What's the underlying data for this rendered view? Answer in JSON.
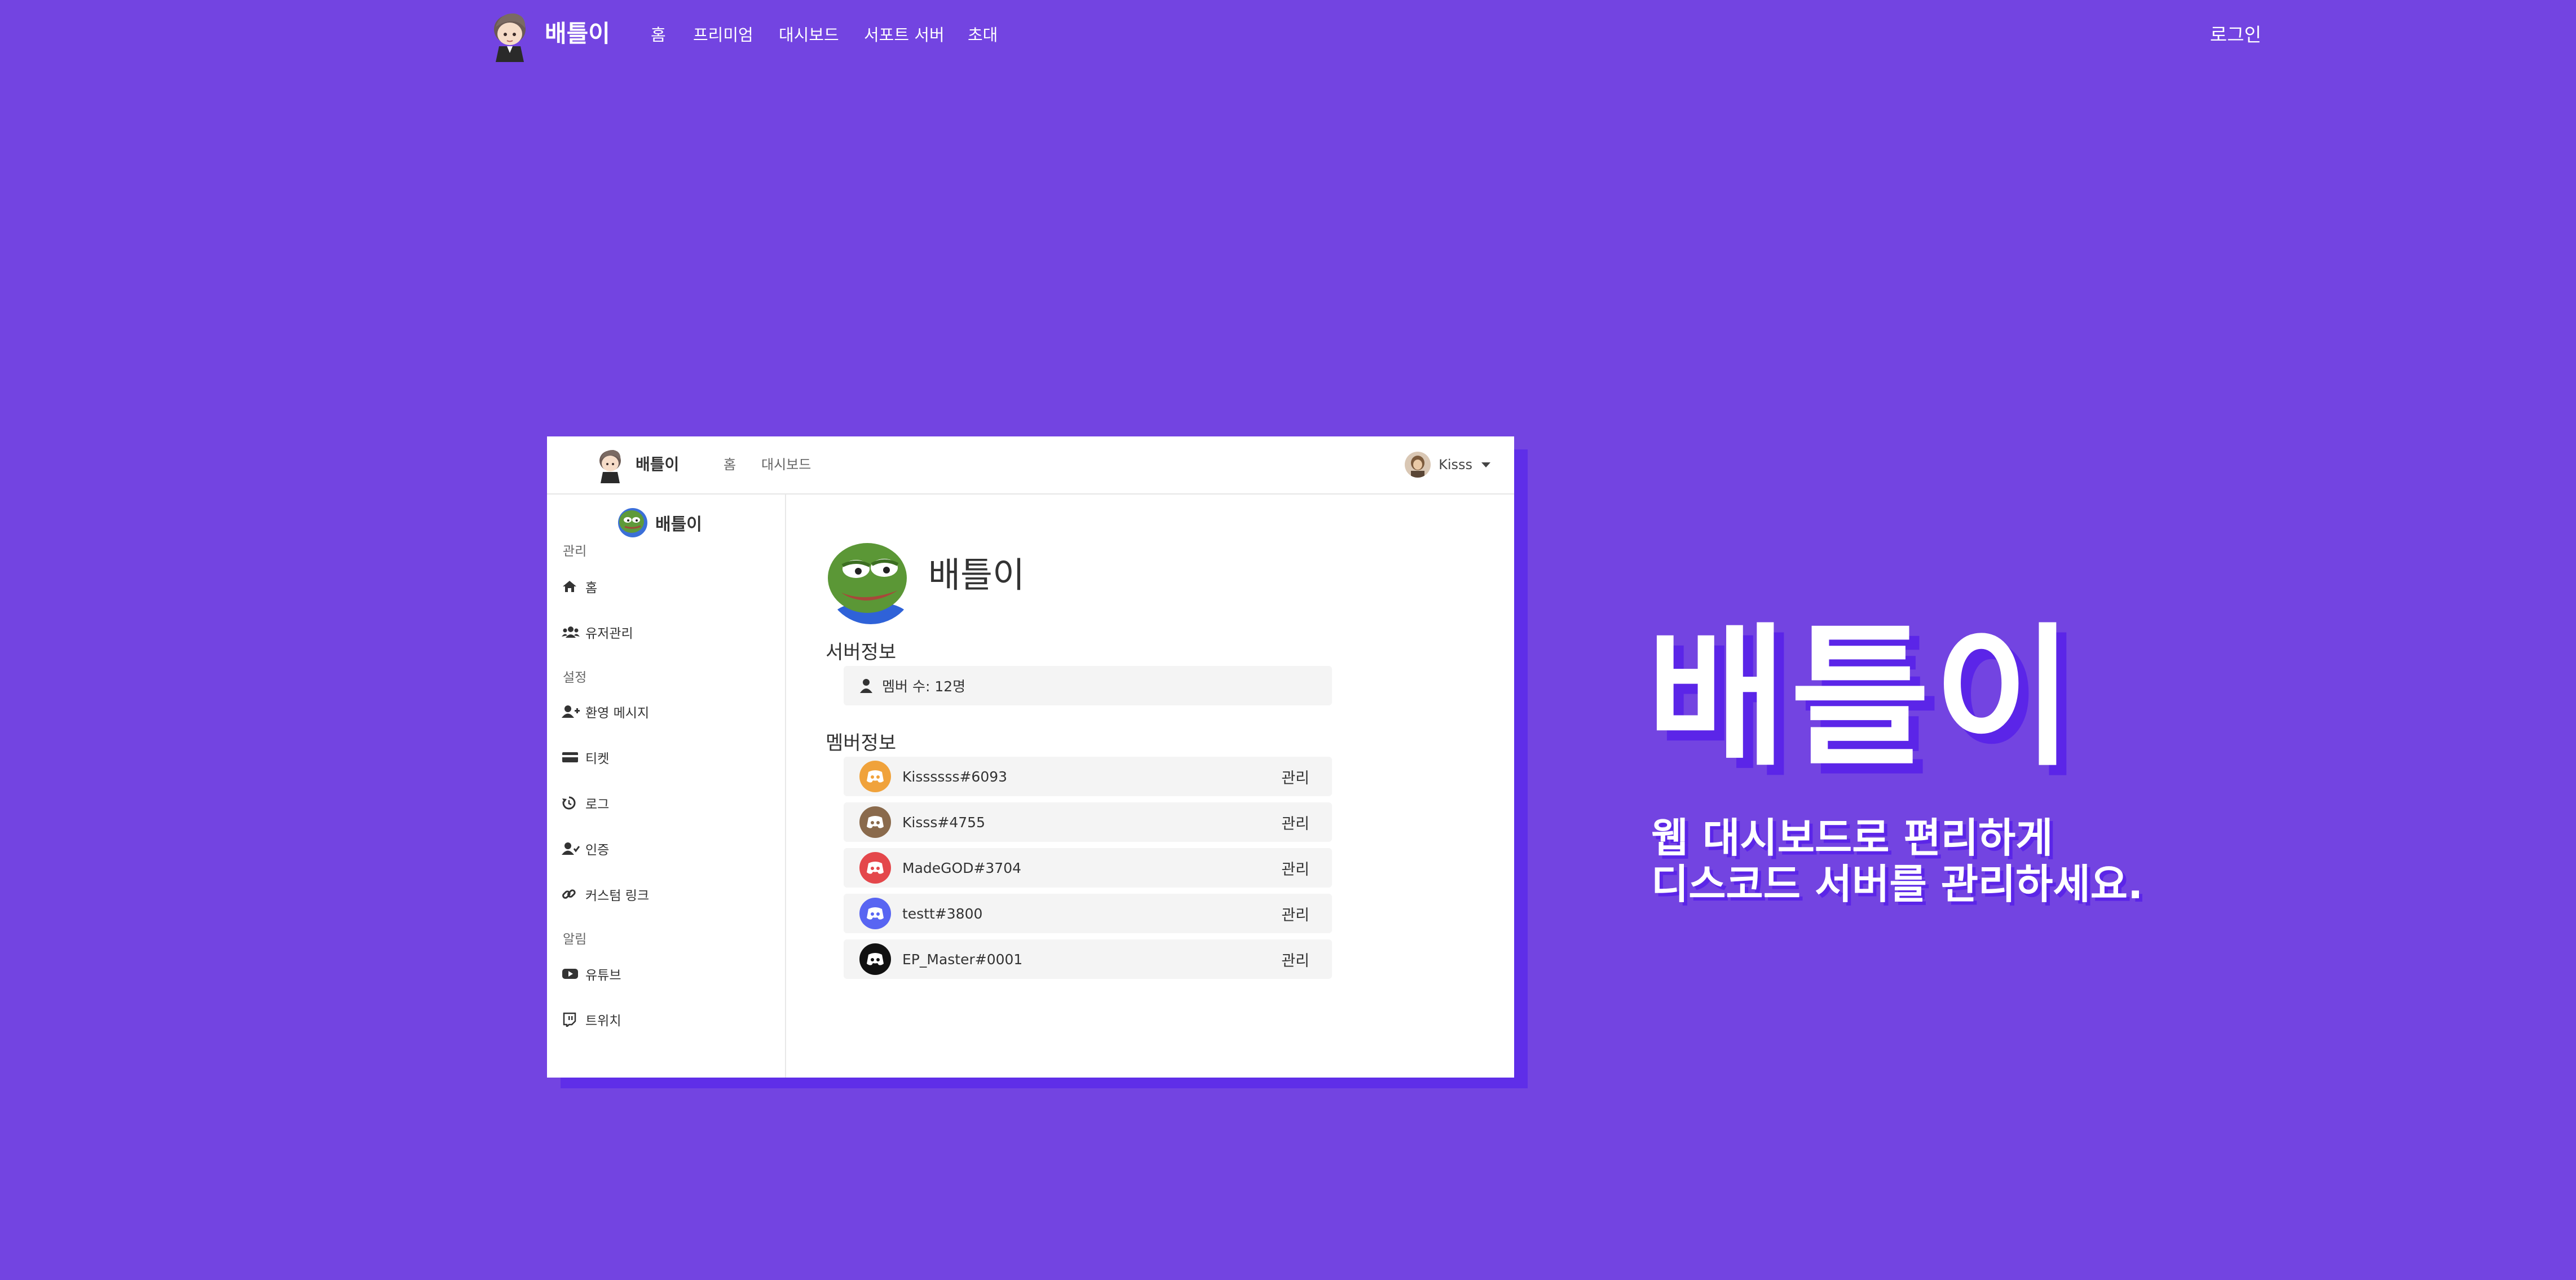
{
  "nav": {
    "brand": "배틀이",
    "items": [
      "홈",
      "프리미엄",
      "대시보드",
      "서포트 서버",
      "초대"
    ],
    "login": "로그인"
  },
  "preview": {
    "brand": "배틀이",
    "nav": [
      "홈",
      "대시보드"
    ],
    "user": {
      "name": "Kisss"
    },
    "sidebar": {
      "server_name": "배틀이",
      "sections": [
        "관리",
        "설정",
        "알림"
      ],
      "items": [
        {
          "label": "홈",
          "icon": "home-icon"
        },
        {
          "label": "유저관리",
          "icon": "users-icon"
        },
        {
          "label": "환영 메시지",
          "icon": "user-plus-icon"
        },
        {
          "label": "티켓",
          "icon": "card-icon"
        },
        {
          "label": "로그",
          "icon": "history-icon"
        },
        {
          "label": "인증",
          "icon": "user-check-icon"
        },
        {
          "label": "커스텀 링크",
          "icon": "link-icon"
        },
        {
          "label": "유튜브",
          "icon": "youtube-icon"
        },
        {
          "label": "트위치",
          "icon": "twitch-icon"
        }
      ]
    },
    "main": {
      "guild_name": "배틀이",
      "server_info_heading": "서버정보",
      "member_count": "멤버 수: 12명",
      "member_info_heading": "멤버정보",
      "manage_label": "관리",
      "members": [
        {
          "name": "Kissssss#6093",
          "avatar_color": "#f0a23b"
        },
        {
          "name": "Kisss#4755",
          "avatar_color": "#8a6a4c"
        },
        {
          "name": "MadeGOD#3704",
          "avatar_color": "#e4474b"
        },
        {
          "name": "testt#3800",
          "avatar_color": "#5865f2"
        },
        {
          "name": "EP_Master#0001",
          "avatar_color": "#111111"
        }
      ]
    }
  },
  "hero": {
    "title": "배틀이",
    "subtitle_line1": "웹 대시보드로 편리하게",
    "subtitle_line2": "디스코드 서버를 관리하세요."
  },
  "colors": {
    "background": "#7344e1",
    "shadow": "#5b25e8",
    "card": "#ffffff"
  }
}
